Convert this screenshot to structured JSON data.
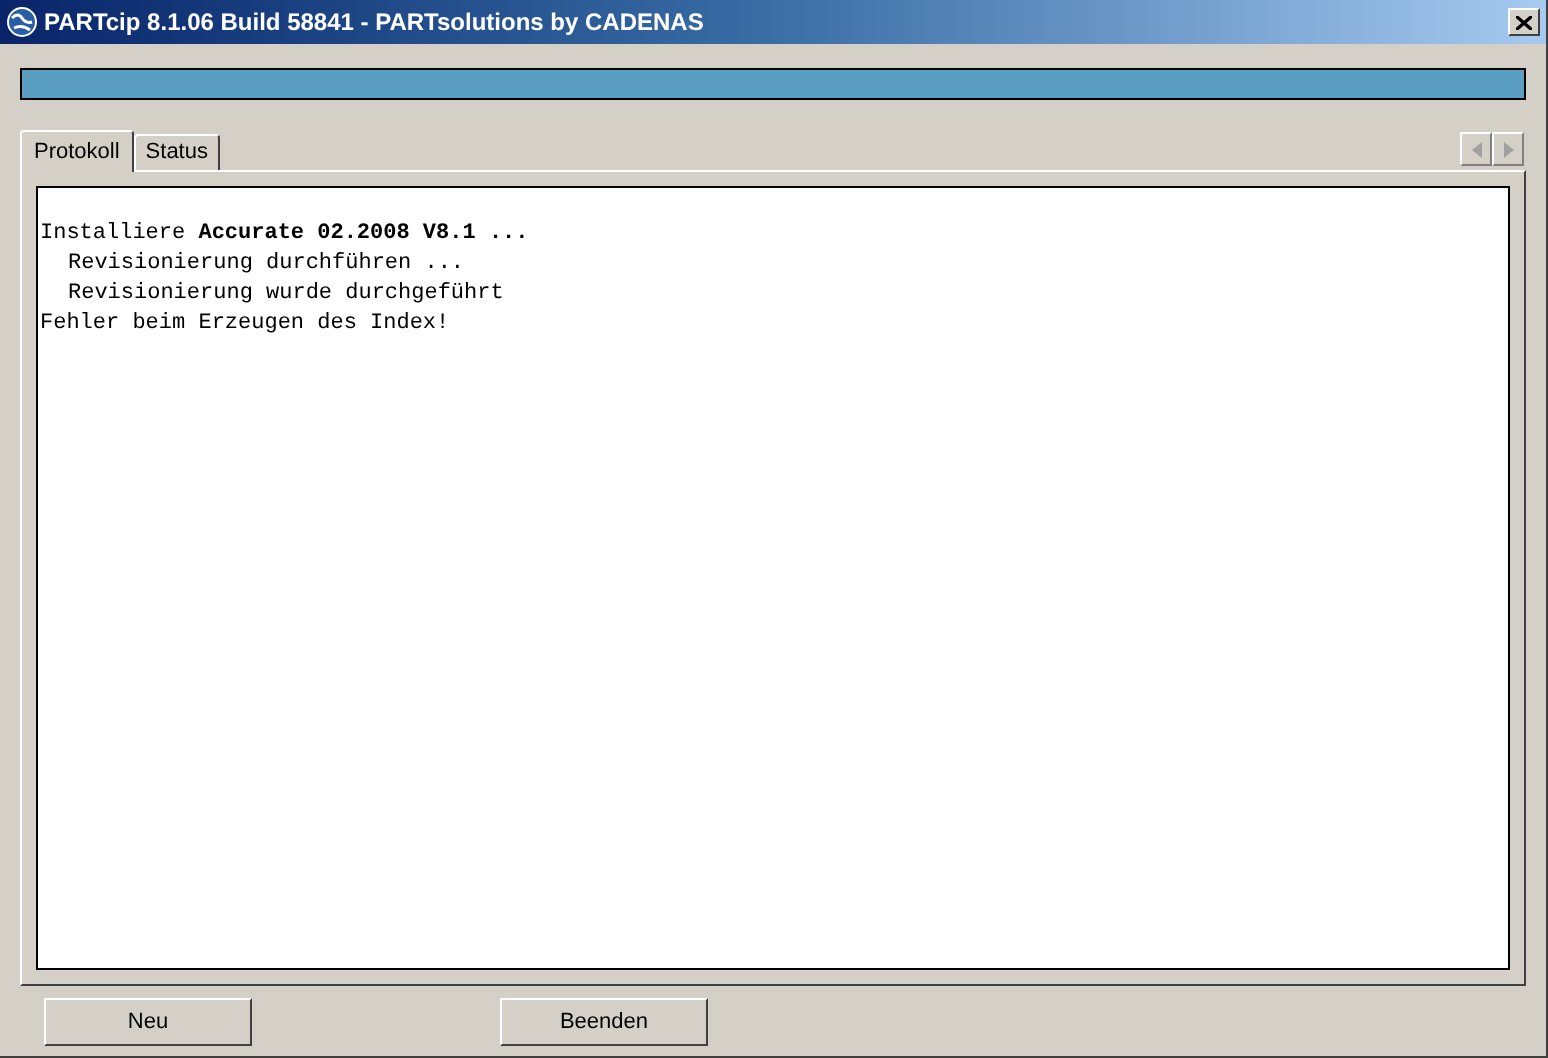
{
  "window": {
    "title": "PARTcip 8.1.06 Build 58841 - PARTsolutions by CADENAS"
  },
  "progress": {
    "level": 1
  },
  "tabs": [
    {
      "label": "Protokoll",
      "selected": true
    },
    {
      "label": "Status",
      "selected": false
    }
  ],
  "log": [
    {
      "text": "Installiere **Accurate 02.2008 V8.1 ...**",
      "children": [
        {
          "text": "Revisionierung durchführen ..."
        },
        {
          "text": "Revisionierung wurde durchgeführt"
        }
      ]
    },
    {
      "text": "Fehler beim Erzeugen des Index!"
    }
  ],
  "buttons": [
    "Neu",
    "Beenden"
  ]
}
